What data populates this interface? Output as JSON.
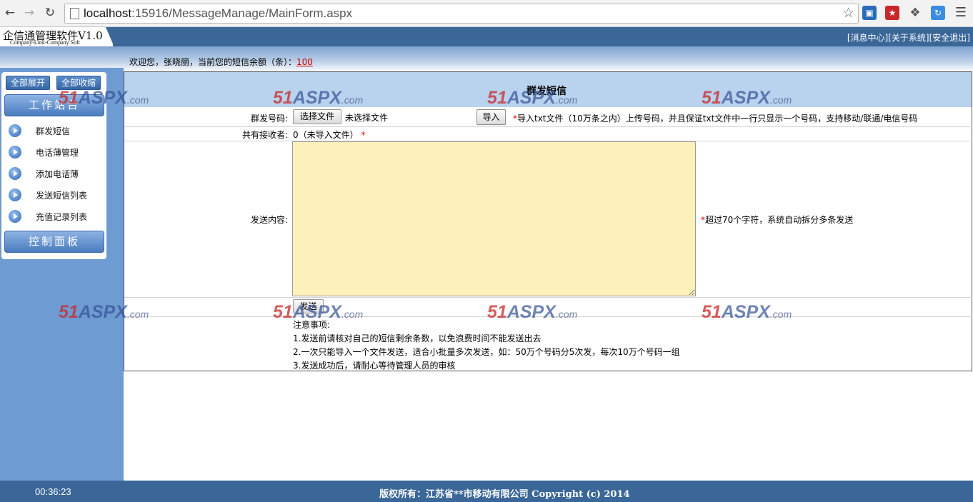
{
  "browser": {
    "url_host": "localhost",
    "url_rest": ":15916/MessageManage/MainForm.aspx",
    "back_icon": "arrow-left",
    "forward_icon": "arrow-right",
    "reload_icon": "reload",
    "star_icon": "star"
  },
  "header": {
    "app_title": "企信通管理软件V1.0",
    "app_subtitle": "Company-Link-Company Soft",
    "links": [
      "[消息中心]",
      "[关于系统]",
      "[安全退出]"
    ]
  },
  "welcome": {
    "text": "欢迎您，张晓丽，当前您的短信余额（条）：",
    "balance": "100"
  },
  "sidebar": {
    "expand_all": "全部展开",
    "collapse_all": "全部收缩",
    "section_work": "工作站台",
    "items": [
      {
        "label": "群发短信"
      },
      {
        "label": "电话薄管理"
      },
      {
        "label": "添加电话薄"
      },
      {
        "label": "发送短信列表"
      },
      {
        "label": "充值记录列表"
      }
    ],
    "section_control": "控制面板"
  },
  "form": {
    "title": "群发短信",
    "numbers_label": "群发号码:",
    "choose_file_btn": "选择文件",
    "no_file_text": "未选择文件",
    "import_btn": "导入",
    "import_required_mark": "*",
    "import_hint": "导入txt文件（10万条之内）上传号码，并且保证txt文件中一行只显示一个号码，支持移动/联通/电信号码",
    "recipients_label": "共有接收者:",
    "recipients_value": "0（未导入文件）",
    "recipients_required_mark": "*",
    "content_label": "发送内容:",
    "content_value": "",
    "content_required_mark": "*",
    "content_hint": "超过70个字符，系统自动拆分多条发送",
    "send_btn": "发送",
    "notes": [
      "注意事项:",
      "1.发送前请核对自己的短信剩余条数，以免浪费时间不能发送出去",
      "2.一次只能导入一个文件发送，适合小批量多次发送，如：50万个号码分5次发，每次10万个号码一组",
      "3.发送成功后，请耐心等待管理人员的审核"
    ]
  },
  "watermark": {
    "num": "51",
    "brand": "ASPX",
    "suffix": ".com"
  },
  "footer": {
    "clock": "00:36:23",
    "copyright": "版权所有：江苏省**市移动有限公司 Copyright (c) 2014"
  }
}
